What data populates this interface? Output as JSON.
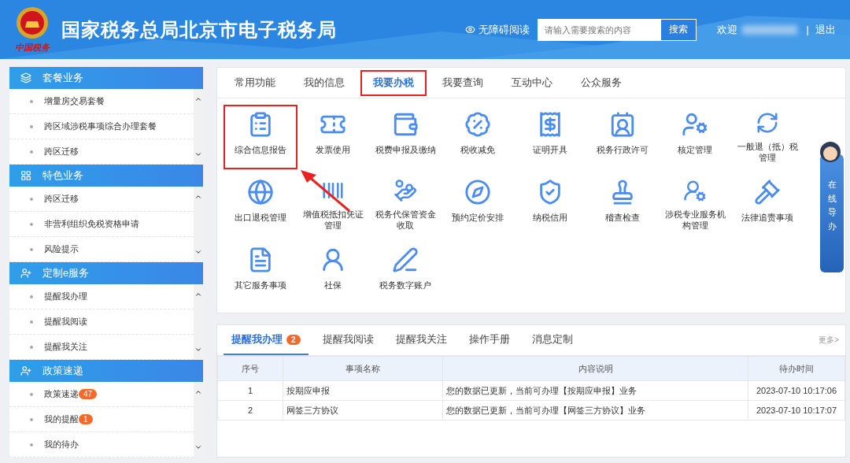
{
  "header": {
    "title": "国家税务总局北京市电子税务局",
    "logo_caption": "中国税务",
    "accessibility": "无障碍阅读",
    "search": {
      "placeholder": "请输入需要搜索的内容",
      "button": "搜索"
    },
    "welcome": "欢迎",
    "separator": "|",
    "logout": "退出"
  },
  "sidebar": [
    {
      "title": "套餐业务",
      "items": [
        {
          "label": "增量房交易套餐"
        },
        {
          "label": "跨区域涉税事项综合办理套餐"
        },
        {
          "label": "跨区迁移"
        }
      ]
    },
    {
      "title": "特色业务",
      "items": [
        {
          "label": "跨区迁移"
        },
        {
          "label": "非营利组织免税资格申请"
        },
        {
          "label": "风险提示"
        }
      ]
    },
    {
      "title": "定制e服务",
      "items": [
        {
          "label": "提醒我办理"
        },
        {
          "label": "提醒我阅读"
        },
        {
          "label": "提醒我关注"
        }
      ]
    },
    {
      "title": "政策速递",
      "items": [
        {
          "label": "政策速递",
          "badge": "47"
        },
        {
          "label": "我的提醒",
          "badge": "1"
        },
        {
          "label": "我的待办"
        }
      ]
    }
  ],
  "tabs": [
    {
      "label": "常用功能",
      "selected": false,
      "highlighted": false
    },
    {
      "label": "我的信息",
      "selected": false,
      "highlighted": false
    },
    {
      "label": "我要办税",
      "selected": true,
      "highlighted": true
    },
    {
      "label": "我要查询",
      "selected": false,
      "highlighted": false
    },
    {
      "label": "互动中心",
      "selected": false,
      "highlighted": false
    },
    {
      "label": "公众服务",
      "selected": false,
      "highlighted": false
    }
  ],
  "services": [
    {
      "label": "综合信息报告",
      "highlighted": true
    },
    {
      "label": "发票使用",
      "highlighted": false
    },
    {
      "label": "税费申报及缴纳",
      "highlighted": false
    },
    {
      "label": "税收减免",
      "highlighted": false
    },
    {
      "label": "证明开具",
      "highlighted": false
    },
    {
      "label": "税务行政许可",
      "highlighted": false
    },
    {
      "label": "核定管理",
      "highlighted": false
    },
    {
      "label": "一般退（抵）税管理",
      "highlighted": false
    },
    {
      "label": "出口退税管理",
      "highlighted": false
    },
    {
      "label": "增值税抵扣凭证管理",
      "highlighted": false
    },
    {
      "label": "税务代保管资金收取",
      "highlighted": false
    },
    {
      "label": "预约定价安排",
      "highlighted": false
    },
    {
      "label": "纳税信用",
      "highlighted": false
    },
    {
      "label": "稽查检查",
      "highlighted": false
    },
    {
      "label": "涉税专业服务机构管理",
      "highlighted": false
    },
    {
      "label": "法律追责事项",
      "highlighted": false
    },
    {
      "label": "其它服务事项",
      "highlighted": false
    },
    {
      "label": "社保",
      "highlighted": false
    },
    {
      "label": "税务数字账户",
      "highlighted": false
    }
  ],
  "guide_widget": {
    "label": "在线导办"
  },
  "reminders": {
    "tabs": [
      {
        "label": "提醒我办理",
        "badge": "2",
        "selected": true
      },
      {
        "label": "提醒我阅读",
        "selected": false
      },
      {
        "label": "提醒我关注",
        "selected": false
      },
      {
        "label": "操作手册",
        "selected": false
      },
      {
        "label": "消息定制",
        "selected": false
      }
    ],
    "more": "更多>",
    "table": {
      "columns": [
        "序号",
        "事项名称",
        "内容说明",
        "待办时间"
      ],
      "rows": [
        [
          "1",
          "按期应申报",
          "您的数据已更新，当前可办理【按期应申报】业务",
          "2023-07-10 10:17:06"
        ],
        [
          "2",
          "网签三方协议",
          "您的数据已更新，当前可办理【网签三方协议】业务",
          "2023-07-10 10:17:07"
        ]
      ]
    }
  }
}
